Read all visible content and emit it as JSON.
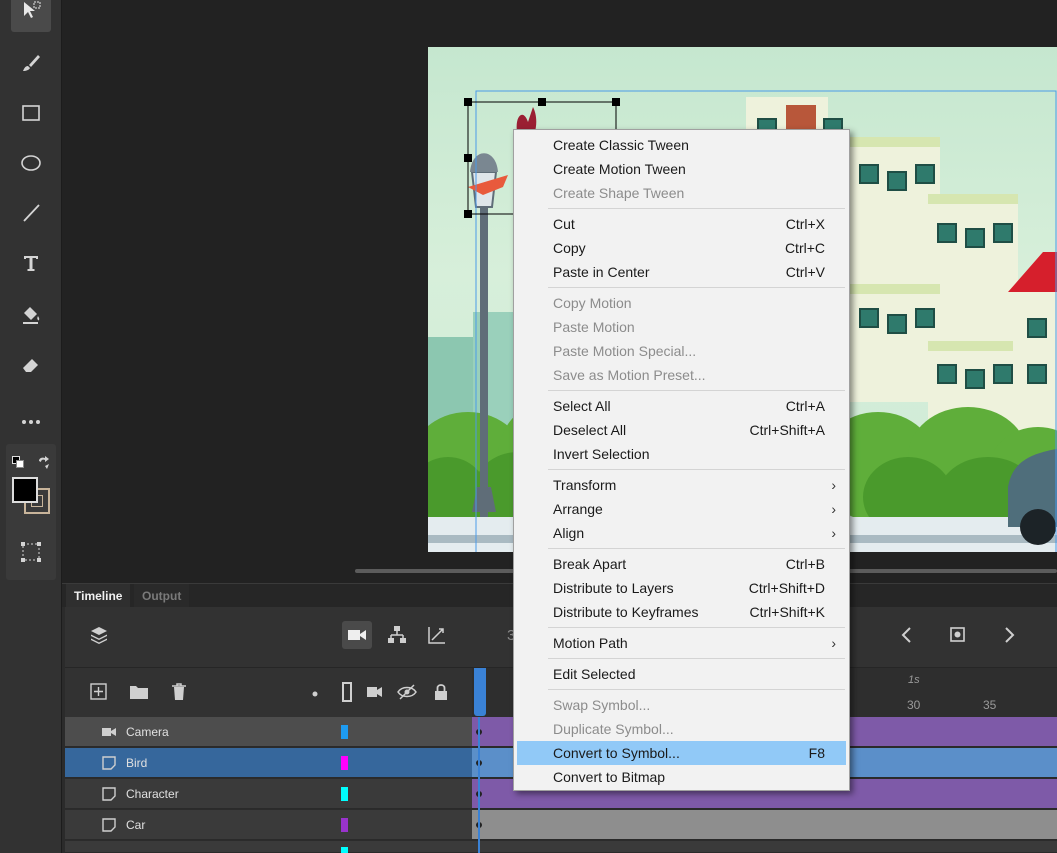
{
  "toolbar": {
    "tools": [
      "selection-icon",
      "brush-icon",
      "rectangle-icon",
      "oval-icon",
      "line-icon",
      "text-icon",
      "paint-bucket-icon",
      "eraser-icon",
      "more-icon",
      "swap-colors-icon",
      "free-transform-icon"
    ],
    "stroke_color": "#000000",
    "fill_color": "#c8b49a"
  },
  "timeline": {
    "tabs": {
      "timeline": "Timeline",
      "output": "Output"
    },
    "frame_counter": "3",
    "ruler": {
      "label_1s": "1s",
      "ticks": [
        "30",
        "35"
      ]
    },
    "layers": [
      {
        "name": "Camera",
        "color": "#1e9bf0"
      },
      {
        "name": "Bird",
        "color": "#ff00ff"
      },
      {
        "name": "Character",
        "color": "#00ffff"
      },
      {
        "name": "Car",
        "color": "#9933cc"
      }
    ]
  },
  "context_menu": {
    "groups": [
      [
        {
          "label": "Create Classic Tween",
          "shortcut": "",
          "disabled": false
        },
        {
          "label": "Create Motion Tween",
          "shortcut": "",
          "disabled": false
        },
        {
          "label": "Create Shape Tween",
          "shortcut": "",
          "disabled": true
        }
      ],
      [
        {
          "label": "Cut",
          "shortcut": "Ctrl+X",
          "disabled": false
        },
        {
          "label": "Copy",
          "shortcut": "Ctrl+C",
          "disabled": false
        },
        {
          "label": "Paste in Center",
          "shortcut": "Ctrl+V",
          "disabled": false
        }
      ],
      [
        {
          "label": "Copy Motion",
          "shortcut": "",
          "disabled": true
        },
        {
          "label": "Paste Motion",
          "shortcut": "",
          "disabled": true
        },
        {
          "label": "Paste Motion Special...",
          "shortcut": "",
          "disabled": true
        },
        {
          "label": "Save as Motion Preset...",
          "shortcut": "",
          "disabled": true
        }
      ],
      [
        {
          "label": "Select All",
          "shortcut": "Ctrl+A",
          "disabled": false
        },
        {
          "label": "Deselect All",
          "shortcut": "Ctrl+Shift+A",
          "disabled": false
        },
        {
          "label": "Invert Selection",
          "shortcut": "",
          "disabled": false
        }
      ],
      [
        {
          "label": "Transform",
          "submenu": true
        },
        {
          "label": "Arrange",
          "submenu": true
        },
        {
          "label": "Align",
          "submenu": true
        }
      ],
      [
        {
          "label": "Break Apart",
          "shortcut": "Ctrl+B",
          "disabled": false
        },
        {
          "label": "Distribute to Layers",
          "shortcut": "Ctrl+Shift+D",
          "disabled": false
        },
        {
          "label": "Distribute to Keyframes",
          "shortcut": "Ctrl+Shift+K",
          "disabled": false
        }
      ],
      [
        {
          "label": "Motion Path",
          "submenu": true
        }
      ],
      [
        {
          "label": "Edit Selected",
          "shortcut": "",
          "disabled": false
        }
      ],
      [
        {
          "label": "Swap Symbol...",
          "shortcut": "",
          "disabled": true
        },
        {
          "label": "Duplicate Symbol...",
          "shortcut": "",
          "disabled": true
        },
        {
          "label": "Convert to Symbol...",
          "shortcut": "F8",
          "disabled": false,
          "highlighted": true
        },
        {
          "label": "Convert to Bitmap",
          "shortcut": "",
          "disabled": false
        }
      ]
    ]
  }
}
